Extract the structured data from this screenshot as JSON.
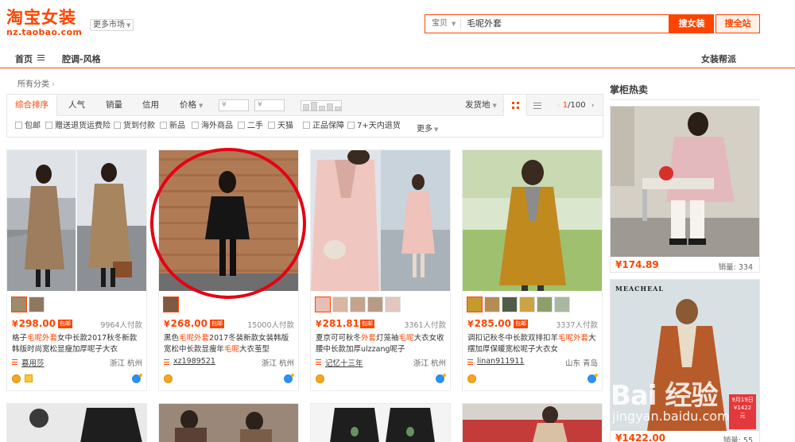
{
  "header": {
    "logo": "淘宝女装",
    "logo_url": "nz.taobao.com",
    "market": "更多市场",
    "search_scope": "宝贝",
    "search_query": "毛呢外套",
    "btn_search": "搜女装",
    "btn_all": "搜全站"
  },
  "nav": {
    "home": "首页",
    "style": "腔调-风格",
    "help": "女装帮派"
  },
  "breadcrumb": "所有分类",
  "sortbar": {
    "tabs": [
      "综合排序",
      "人气",
      "销量",
      "信用",
      "价格"
    ],
    "price_from": "¥",
    "price_to": "¥",
    "price_dash": "-",
    "ship": "发货地",
    "page_current": "1",
    "page_total": "/100"
  },
  "filters": [
    "包邮",
    "赠送退货运费险",
    "货到付款",
    "新品",
    "海外商品",
    "二手",
    "天猫",
    "正品保障",
    "7+天内退货"
  ],
  "more": "更多",
  "products": [
    {
      "price": "298.00",
      "freeship": "包邮",
      "sold": "9964人付款",
      "title_pre": "格子",
      "title_hl": "毛呢外套",
      "title_post": "女中长款2017秋冬新款韩版时尚宽松显瘦加厚呢子大衣",
      "shop": "慕用莎",
      "location": "浙江 杭州"
    },
    {
      "price": "268.00",
      "freeship": "包邮",
      "sold": "15000人付款",
      "title_pre": "黑色",
      "title_hl": "毛呢外套",
      "title_post": "2017冬装新款女装韩版宽松中长款显瘦年",
      "title_hl2": "毛呢",
      "title_post2": "大衣茧型",
      "shop": "xz1989521",
      "location": "浙江 杭州"
    },
    {
      "price": "281.81",
      "freeship": "包邮",
      "sold": "3361人付款",
      "title_pre": "夏京可可秋冬",
      "title_hl": "外套",
      "title_post": "灯笼袖",
      "title_hl2": "毛呢",
      "title_post2": "大衣女收腰中长款加厚ulzzang呢子",
      "shop": "记忆十三年",
      "location": "浙江 杭州"
    },
    {
      "price": "285.00",
      "freeship": "包邮",
      "sold": "3337人付款",
      "title_pre": "调扣记秋冬中长款双排扣羊",
      "title_hl": "毛呢外套",
      "title_post": "大摆加厚保暖宽松呢子大衣女",
      "shop": "linan911911",
      "location": "山东 青岛"
    }
  ],
  "sidebar": {
    "title": "掌柜热卖",
    "items": [
      {
        "price": "174.89",
        "sold": "销量: 334"
      },
      {
        "brand": "MEACHEAL",
        "promo_line1": "9月19日",
        "promo_line2": "¥1422",
        "promo_line3": "元",
        "price": "1422.00",
        "sold": "销量: 55"
      }
    ]
  },
  "watermark": {
    "brand": "Bai 经验",
    "url": "jingyan.baidu.com"
  }
}
